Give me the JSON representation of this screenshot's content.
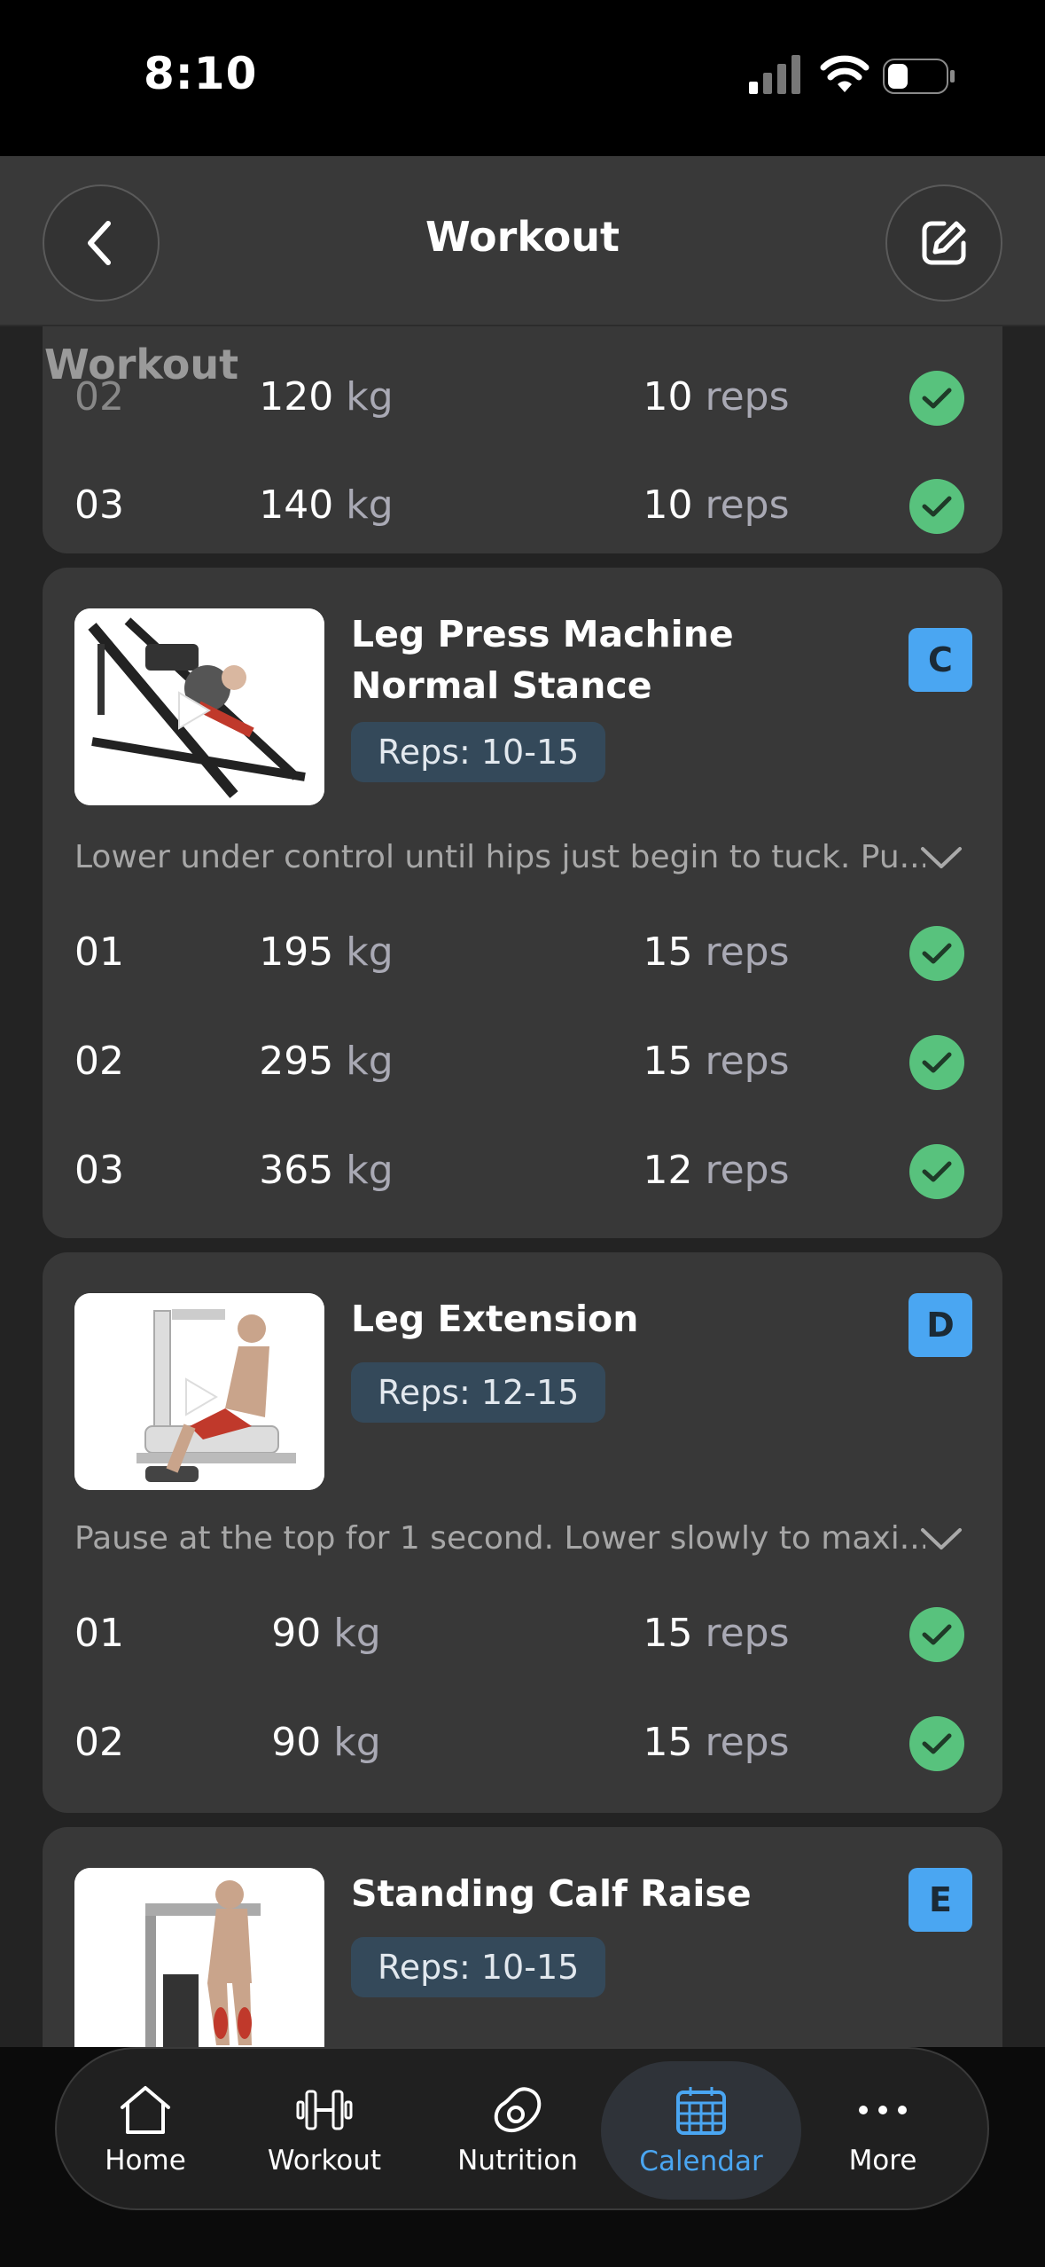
{
  "status": {
    "time": "8:10"
  },
  "header": {
    "title": "Workout"
  },
  "ghost_title": "Workout",
  "cards": [
    {
      "sets": [
        {
          "num": "02",
          "weight": "120",
          "weight_unit": "kg",
          "reps": "10",
          "reps_unit": "reps"
        },
        {
          "num": "03",
          "weight": "140",
          "weight_unit": "kg",
          "reps": "10",
          "reps_unit": "reps"
        }
      ]
    },
    {
      "name_line1": "Leg Press Machine",
      "name_line2": "Normal Stance",
      "reps_badge": "Reps: 10-15",
      "letter": "C",
      "note": "Lower under control until hips just begin to tuck. Pu...",
      "sets": [
        {
          "num": "01",
          "weight": "195",
          "weight_unit": "kg",
          "reps": "15",
          "reps_unit": "reps"
        },
        {
          "num": "02",
          "weight": "295",
          "weight_unit": "kg",
          "reps": "15",
          "reps_unit": "reps"
        },
        {
          "num": "03",
          "weight": "365",
          "weight_unit": "kg",
          "reps": "12",
          "reps_unit": "reps"
        }
      ]
    },
    {
      "name_line1": "Leg Extension",
      "reps_badge": "Reps: 12-15",
      "letter": "D",
      "note": "Pause at the top for 1 second. Lower slowly to maxi...",
      "sets": [
        {
          "num": "01",
          "weight": "90",
          "weight_unit": "kg",
          "reps": "15",
          "reps_unit": "reps"
        },
        {
          "num": "02",
          "weight": "90",
          "weight_unit": "kg",
          "reps": "15",
          "reps_unit": "reps"
        }
      ]
    },
    {
      "name_line1": "Standing Calf Raise",
      "reps_badge": "Reps: 10-15",
      "letter": "E"
    }
  ],
  "tabs": [
    {
      "label": "Home",
      "icon": "home-icon"
    },
    {
      "label": "Workout",
      "icon": "dumbbell-icon"
    },
    {
      "label": "Nutrition",
      "icon": "avocado-icon"
    },
    {
      "label": "Calendar",
      "icon": "calendar-icon",
      "active": true
    },
    {
      "label": "More",
      "icon": "more-icon"
    }
  ],
  "colors": {
    "accent": "#4aa6f2",
    "check": "#58c27d",
    "card": "#383838",
    "background": "#232323"
  }
}
